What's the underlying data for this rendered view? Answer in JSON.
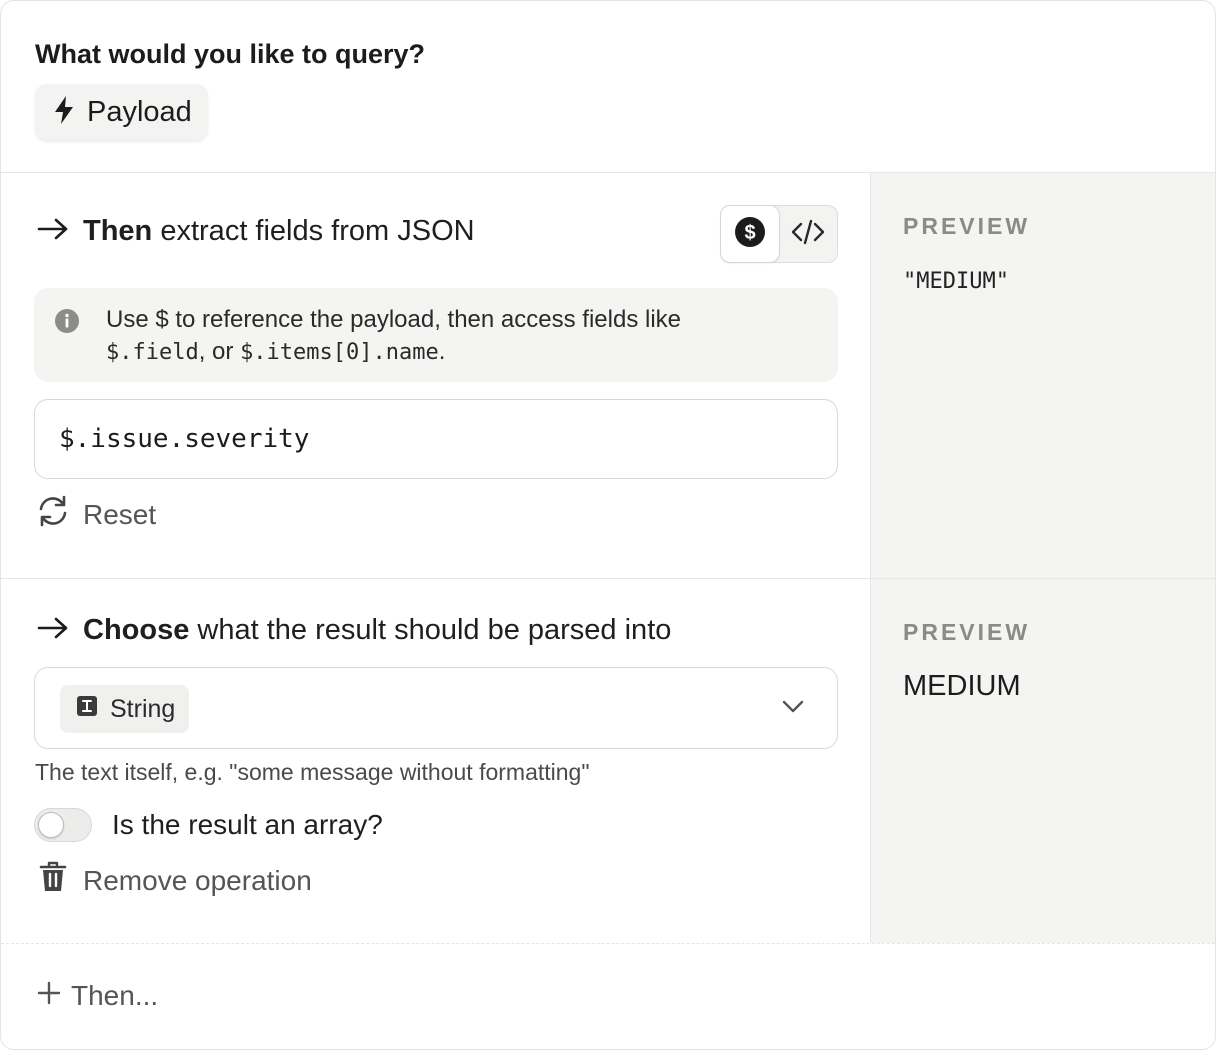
{
  "header": {
    "title": "What would you like to query?",
    "source_chip": {
      "label": "Payload",
      "icon": "bolt-icon"
    }
  },
  "extract": {
    "title_strong": "Then",
    "title_rest": "extract fields from JSON",
    "mode_toggle": {
      "options": [
        "dollar-icon",
        "code-icon"
      ],
      "selected": "dollar-icon"
    },
    "info": {
      "part1": "Use $ to reference the payload, then access fields like",
      "code1": "$.field",
      "part2": ", or ",
      "code2": "$.items[0]",
      "code3": ".name",
      "part3": "."
    },
    "path_value": "$.issue.severity",
    "reset_label": "Reset",
    "preview_label": "PREVIEW",
    "preview_value": "\"MEDIUM\""
  },
  "parse": {
    "title_strong": "Choose",
    "title_rest": "what the result should be parsed into",
    "selected_type": "String",
    "helper": "The text itself, e.g. \"some message without formatting\"",
    "array_toggle_label": "Is the result an array?",
    "array_toggle_on": false,
    "remove_label": "Remove operation",
    "preview_label": "PREVIEW",
    "preview_value": "MEDIUM"
  },
  "footer": {
    "add_label": "Then..."
  },
  "colors": {
    "panel_bg": "#f4f4f2",
    "accent_dark": "#1c1c1c",
    "muted_text": "#8a8a88"
  }
}
